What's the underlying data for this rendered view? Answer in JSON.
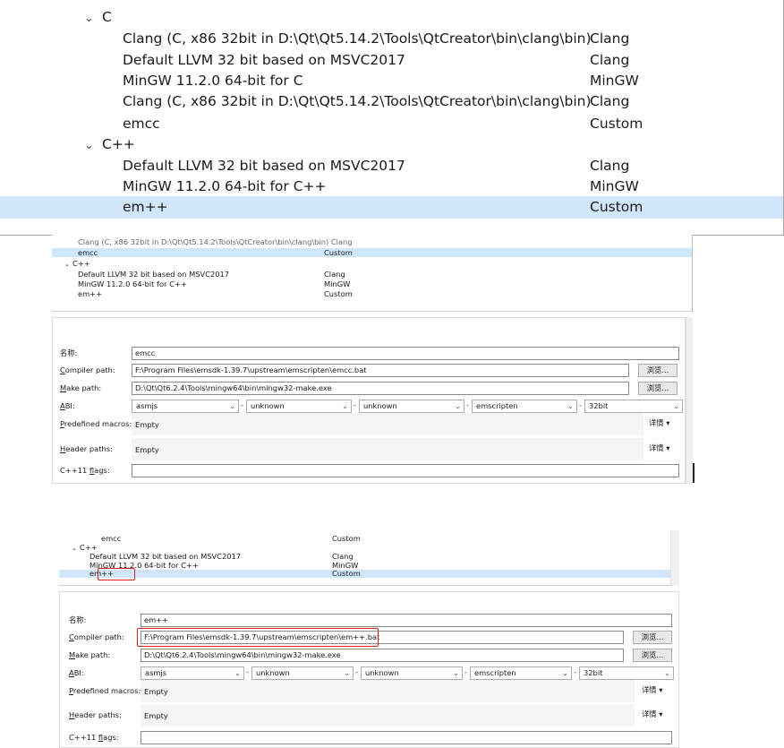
{
  "panel1": {
    "group_c": {
      "chevron": "chevron-down-icon",
      "label": "C"
    },
    "c_items": [
      {
        "name": "Clang (C, x86 32bit in D:\\Qt\\Qt5.14.2\\Tools\\QtCreator\\bin\\clang\\bin)",
        "type": "Clang"
      },
      {
        "name": "Default LLVM 32 bit based on MSVC2017",
        "type": "Clang"
      },
      {
        "name": "MinGW 11.2.0 64-bit for C",
        "type": "MinGW"
      },
      {
        "name": "Clang (C, x86 32bit in D:\\Qt\\Qt5.14.2\\Tools\\QtCreator\\bin\\clang\\bin)",
        "type": "Clang"
      },
      {
        "name": "emcc",
        "type": "Custom"
      }
    ],
    "group_cpp": {
      "chevron": "chevron-down-icon",
      "label": "C++"
    },
    "cpp_items": [
      {
        "name": "Default LLVM 32 bit based on MSVC2017",
        "type": "Clang"
      },
      {
        "name": "MinGW 11.2.0 64-bit for C++",
        "type": "MinGW"
      },
      {
        "name": "em++",
        "type": "Custom"
      }
    ]
  },
  "panel2": {
    "cut_row": "Clang (C, x86 32bit in D:\\Qt\\Qt5.14.2\\Tools\\QtCreator\\bin\\clang\\bin)  Clang",
    "emcc": {
      "name": "emcc",
      "type": "Custom"
    },
    "group_cpp": {
      "label": "C++"
    },
    "cpp_items": [
      {
        "name": "Default LLVM 32 bit based on MSVC2017",
        "type": "Clang"
      },
      {
        "name": "MinGW 11.2.0 64-bit for C++",
        "type": "MinGW"
      },
      {
        "name": "em++",
        "type": "Custom"
      }
    ],
    "form": {
      "name_label": "名称:",
      "name_value": "emcc",
      "compiler_label": "ompiler path:",
      "compiler_mnemonic": "C",
      "compiler_value": "F:\\Program Files\\emsdk-1.39.7\\upstream\\emscripten\\emcc.bat",
      "make_label": "ake path:",
      "make_mnemonic": "M",
      "make_value": "D:\\Qt\\Qt6.2.4\\Tools\\mingw64\\bin\\mingw32-make.exe",
      "browse_label": "浏览...",
      "abi_label": "BI:",
      "abi_mnemonic": "A",
      "abi": [
        "asmjs",
        "unknown",
        "unknown",
        "emscripten",
        "32bit"
      ],
      "abi_sep": "-",
      "macros_label": "redefined macros:",
      "macros_mnemonic": "P",
      "macros_value": "Empty",
      "headers_label": "eader paths:",
      "headers_mnemonic": "H",
      "headers_value": "Empty",
      "details_label": "详情 ▾",
      "cxx11_label": "C++11 ",
      "cxx11_mnemonic": "f",
      "cxx11_rest": "lags:"
    }
  },
  "panel3": {
    "emcc": {
      "name": "emcc",
      "type": "Custom"
    },
    "group_cpp": {
      "label": "C++"
    },
    "cpp_items": [
      {
        "name": "Default LLVM 32 bit based on MSVC2017",
        "type": "Clang"
      },
      {
        "name": "MinGW 11.2.0 64-bit for C++",
        "type": "MinGW"
      },
      {
        "name": "em++",
        "type": "Custom"
      }
    ],
    "form": {
      "name_label": "名称:",
      "name_value": "em++",
      "compiler_label": "ompiler path:",
      "compiler_mnemonic": "C",
      "compiler_value": "F:\\Program Files\\emsdk-1.39.7\\upstream\\emscripten\\em++.bat",
      "make_label": "ake path:",
      "make_mnemonic": "M",
      "make_value": "D:\\Qt\\Qt6.2.4\\Tools\\mingw64\\bin\\mingw32-make.exe",
      "browse_label": "浏览...",
      "abi_label": "BI:",
      "abi_mnemonic": "A",
      "abi": [
        "asmjs",
        "unknown",
        "unknown",
        "emscripten",
        "32bit"
      ],
      "abi_sep": "-",
      "macros_label": "redefined macros:",
      "macros_mnemonic": "P",
      "macros_value": "Empty",
      "headers_label": "eader paths:",
      "headers_mnemonic": "H",
      "headers_value": "Empty",
      "details_label": "详情 ▾",
      "cxx11_label": "C++11 ",
      "cxx11_mnemonic": "f",
      "cxx11_rest": "lags:"
    }
  },
  "colors": {
    "selection": "#cfe6fb",
    "highlight": "#e02020"
  }
}
